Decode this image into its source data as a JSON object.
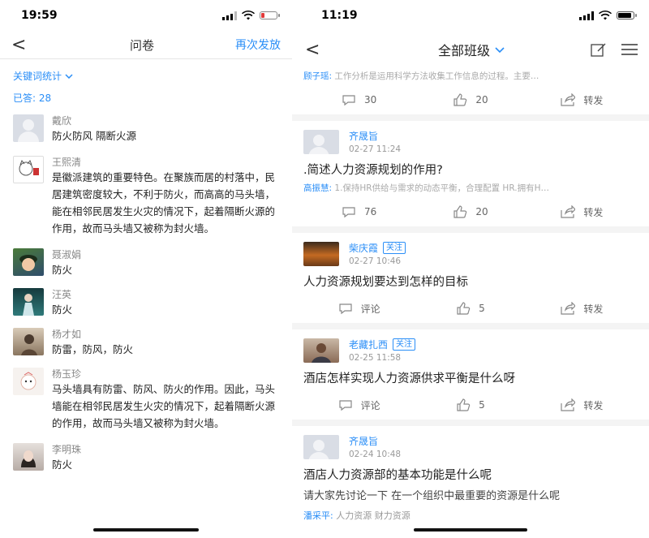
{
  "left": {
    "status_time": "19:59",
    "nav": {
      "back": "<",
      "title": "问卷",
      "action": "再次发放"
    },
    "keyword_stats": "关键词统计",
    "answered": "已答: 28",
    "answers": [
      {
        "name": "戴欣",
        "text": "防火防风  隔断火源",
        "avatar": "default"
      },
      {
        "name": "王熙清",
        "text": "是徽派建筑的重要特色。在聚族而居的村落中，民居建筑密度较大，不利于防火，而高高的马头墙，能在相邻民居发生火灾的情况下，起着隔断火源的作用，故而马头墙又被称为封火墙。",
        "avatar": "cat-sketch"
      },
      {
        "name": "聂淑娟",
        "text": "防火",
        "avatar": "anime-boy"
      },
      {
        "name": "汪英",
        "text": "防火",
        "avatar": "night-girl"
      },
      {
        "name": "杨才如",
        "text": "防雷，防风，防火",
        "avatar": "sepia-girl"
      },
      {
        "name": "杨玉珍",
        "text": "马头墙具有防雷、防风、防火的作用。因此，马头墙能在相邻民居发生火灾的情况下，起着隔断火源的作用，故而马头墙又被称为封火墙。",
        "avatar": "cartoon-face"
      },
      {
        "name": "李明珠",
        "text": "防火",
        "avatar": "photo-girl"
      }
    ]
  },
  "right": {
    "status_time": "11:19",
    "nav": {
      "back": "<",
      "title": "全部班级"
    },
    "top_card": {
      "reply_name": "顾子瑶:",
      "reply_text": "工作分析是运用科学方法收集工作信息的过程。主要…",
      "comments": "30",
      "likes": "20",
      "share": "转发"
    },
    "posts": [
      {
        "name": "齐晟旨",
        "badge": "",
        "time": "02-27 11:24",
        "avatar": "default",
        "question": ".简述人力资源规划的作用?",
        "reply_name": "高振慧:",
        "reply_text": "1.保持HR供给与需求的动态平衡，合理配置 HR.拥有H…",
        "comments": "76",
        "likes": "20",
        "share": "转发"
      },
      {
        "name": "柴庆霞",
        "badge": "关注",
        "time": "02-27 10:46",
        "avatar": "orange-photo",
        "question": "人力资源规划要达到怎样的目标",
        "comments": "评论",
        "likes": "5",
        "share": "转发"
      },
      {
        "name": "老藏扎西",
        "badge": "关注",
        "time": "02-25 11:58",
        "avatar": "man-photo",
        "question": "酒店怎样实现人力资源供求平衡是什么呀",
        "comments": "评论",
        "likes": "5",
        "share": "转发"
      },
      {
        "name": "齐晟旨",
        "badge": "",
        "time": "02-24 10:48",
        "avatar": "default",
        "question": "酒店人力资源部的基本功能是什么呢",
        "desc": "请大家先讨论一下 在一个组织中最重要的资源是什么呢",
        "tag_name": "潘采平:",
        "tags": "人力资源   财力资源"
      }
    ]
  },
  "colors": {
    "accent": "#2a8ef7",
    "battery_low": "#e23b3b"
  }
}
